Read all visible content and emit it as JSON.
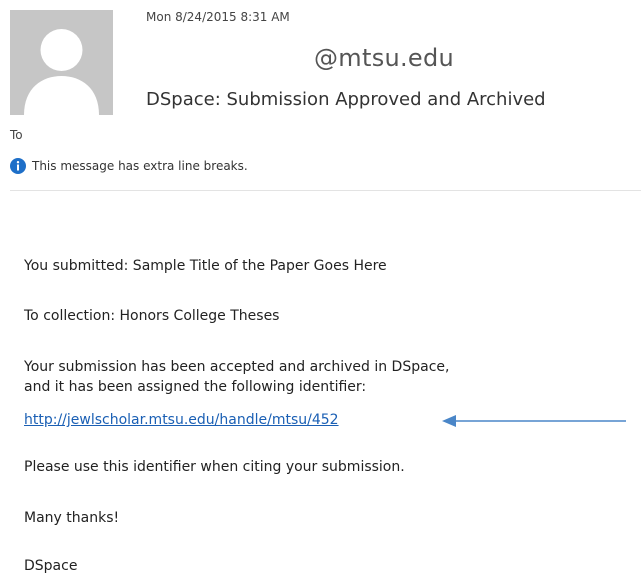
{
  "header": {
    "timestamp": "Mon 8/24/2015 8:31 AM",
    "sender": "@mtsu.edu",
    "subject": "DSpace: Submission Approved and Archived",
    "to_label": "To",
    "info_message": "This message has extra line breaks."
  },
  "icons": {
    "avatar": "person-avatar-icon",
    "info": "info-icon",
    "arrow": "arrow-left-icon"
  },
  "colors": {
    "link": "#1a5fb4",
    "info_icon": "#1e6fc8",
    "arrow": "#4a86c8",
    "avatar_bg": "#c6c6c6"
  },
  "message": {
    "submitted": "You submitted: Sample Title of the Paper Goes Here",
    "collection": "To collection: Honors College Theses",
    "accepted_line1": "Your submission has been accepted and archived in DSpace,",
    "accepted_line2": "and it has been assigned the following identifier:",
    "identifier_link": "http://jewlscholar.mtsu.edu/handle/mtsu/452",
    "citing_note": "Please use this identifier when citing your submission.",
    "thanks": "Many thanks!",
    "signature": "DSpace"
  }
}
